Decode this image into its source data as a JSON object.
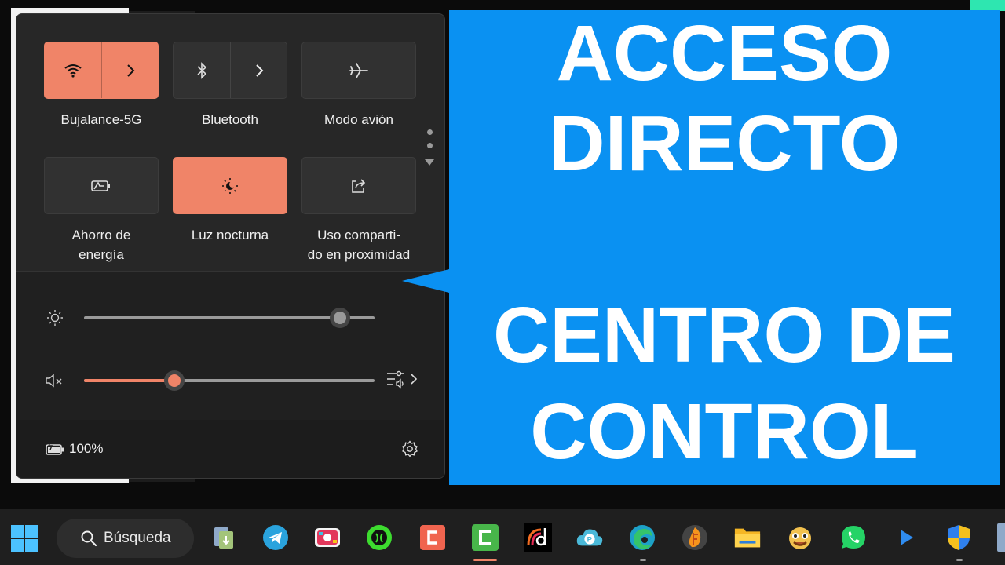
{
  "quick_settings": {
    "tiles": [
      {
        "label": "Bujalance-5G",
        "icon": "wifi-icon",
        "state": "on"
      },
      {
        "label": "Bluetooth",
        "icon": "bluetooth-icon",
        "state": "off"
      },
      {
        "label": "Modo avión",
        "icon": "airplane-icon",
        "state": "off"
      },
      {
        "label_line1": "Ahorro de",
        "label_line2": "energía",
        "icon": "battery-saver-icon",
        "state": "off"
      },
      {
        "label": "Luz nocturna",
        "icon": "night-light-icon",
        "state": "on"
      },
      {
        "label_line1": "Uso comparti-",
        "label_line2": "do en proximidad",
        "icon": "nearby-share-icon",
        "state": "off"
      }
    ],
    "brightness": {
      "value": 0.88
    },
    "volume": {
      "value": 0.31,
      "muted": true
    },
    "battery": {
      "text": "100%"
    }
  },
  "callout": {
    "line1": "ACCESO",
    "line2": "DIRECTO",
    "line3": "CENTRO DE",
    "line4": "CONTROL"
  },
  "taskbar": {
    "search_label": "Búsqueda",
    "apps": [
      "file-explorer-utility-icon",
      "telegram-icon",
      "screen-recorder-icon",
      "razer-icon",
      "clipchamp-icon",
      "camtasia-icon",
      "davinci-icon",
      "cloud-app-icon",
      "edge-icon",
      "fl-studio-icon",
      "files-icon",
      "emoji-app-icon",
      "whatsapp-icon",
      "media-player-icon",
      "security-shield-icon"
    ]
  },
  "colors": {
    "accent": "#f08468",
    "callout_blue": "#0a91f2",
    "panel": "#272727"
  }
}
